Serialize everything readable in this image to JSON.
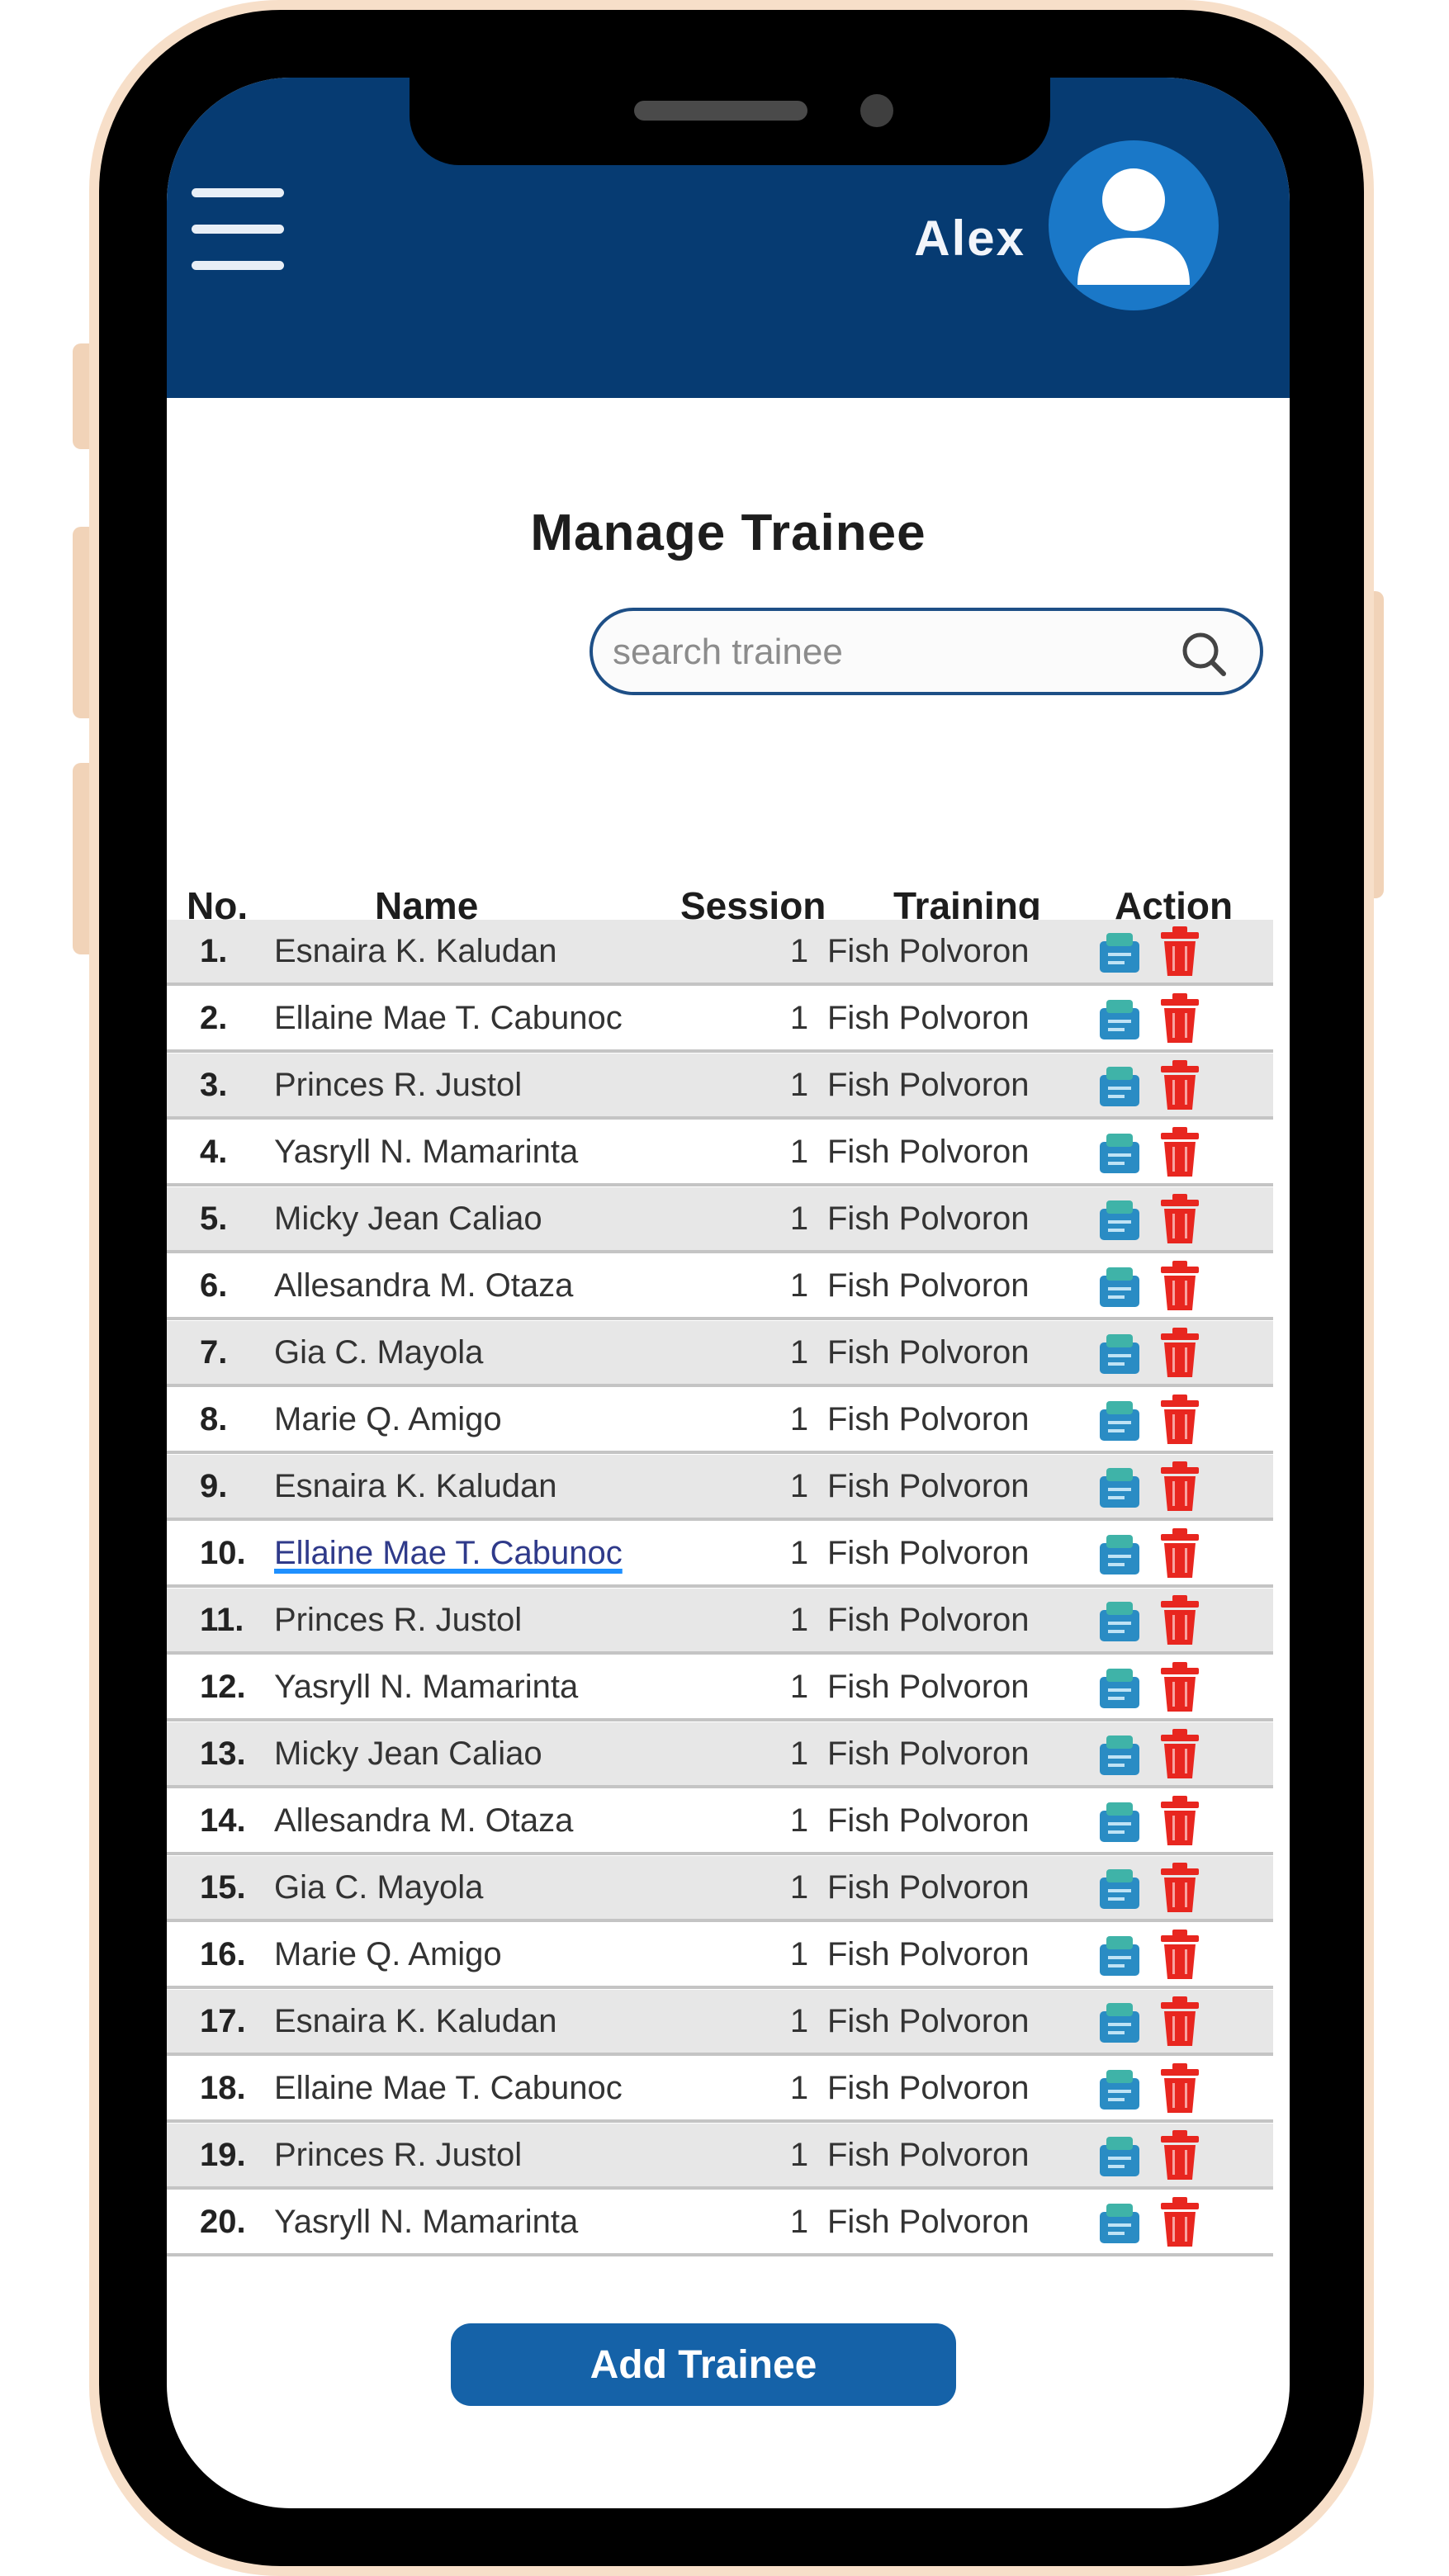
{
  "header": {
    "user_name": "Alex"
  },
  "page_title": "Manage Trainee",
  "search": {
    "placeholder": "search trainee",
    "value": ""
  },
  "table": {
    "columns": [
      "No.",
      "Name",
      "Session",
      "Training",
      "Action"
    ],
    "rows": [
      {
        "no": "1.",
        "name": "Esnaira K. Kaludan",
        "session": "1",
        "training": "Fish Polvoron"
      },
      {
        "no": "2.",
        "name": "Ellaine Mae T. Cabunoc",
        "session": "1",
        "training": "Fish Polvoron"
      },
      {
        "no": "3.",
        "name": "Princes R. Justol",
        "session": "1",
        "training": "Fish Polvoron"
      },
      {
        "no": "4.",
        "name": "Yasryll N. Mamarinta",
        "session": "1",
        "training": "Fish Polvoron"
      },
      {
        "no": "5.",
        "name": "Micky Jean Caliao",
        "session": "1",
        "training": "Fish Polvoron"
      },
      {
        "no": "6.",
        "name": "Allesandra M. Otaza",
        "session": "1",
        "training": "Fish Polvoron"
      },
      {
        "no": "7.",
        "name": "Gia C. Mayola",
        "session": "1",
        "training": "Fish Polvoron"
      },
      {
        "no": "8.",
        "name": "Marie Q. Amigo",
        "session": "1",
        "training": "Fish Polvoron"
      },
      {
        "no": "9.",
        "name": "Esnaira K. Kaludan",
        "session": "1",
        "training": "Fish Polvoron"
      },
      {
        "no": "10.",
        "name": "Ellaine Mae T. Cabunoc",
        "session": "1",
        "training": "Fish Polvoron"
      },
      {
        "no": "11.",
        "name": "Princes R. Justol",
        "session": "1",
        "training": "Fish Polvoron"
      },
      {
        "no": "12.",
        "name": "Yasryll N. Mamarinta",
        "session": "1",
        "training": "Fish Polvoron"
      },
      {
        "no": "13.",
        "name": "Micky Jean Caliao",
        "session": "1",
        "training": "Fish Polvoron"
      },
      {
        "no": "14.",
        "name": "Allesandra M. Otaza",
        "session": "1",
        "training": "Fish Polvoron"
      },
      {
        "no": "15.",
        "name": "Gia C. Mayola",
        "session": "1",
        "training": "Fish Polvoron"
      },
      {
        "no": "16.",
        "name": "Marie Q. Amigo",
        "session": "1",
        "training": "Fish Polvoron"
      },
      {
        "no": "17.",
        "name": "Esnaira K. Kaludan",
        "session": "1",
        "training": "Fish Polvoron"
      },
      {
        "no": "18.",
        "name": "Ellaine Mae T. Cabunoc",
        "session": "1",
        "training": "Fish Polvoron"
      },
      {
        "no": "19.",
        "name": "Princes R. Justol",
        "session": "1",
        "training": "Fish Polvoron"
      },
      {
        "no": "20.",
        "name": "Yasryll N. Mamarinta",
        "session": "1",
        "training": "Fish Polvoron"
      }
    ]
  },
  "add_button_label": "Add Trainee",
  "icons": {
    "menu": "hamburger-menu-icon",
    "avatar": "user-avatar-icon",
    "search": "search-icon",
    "edit": "edit-icon",
    "delete": "trash-icon"
  },
  "colors": {
    "header_bg": "#063b72",
    "primary_button": "#1562a8",
    "avatar_bg": "#1a78c8",
    "delete_red": "#e8261f",
    "edit_teal": "#2a8cc4"
  }
}
